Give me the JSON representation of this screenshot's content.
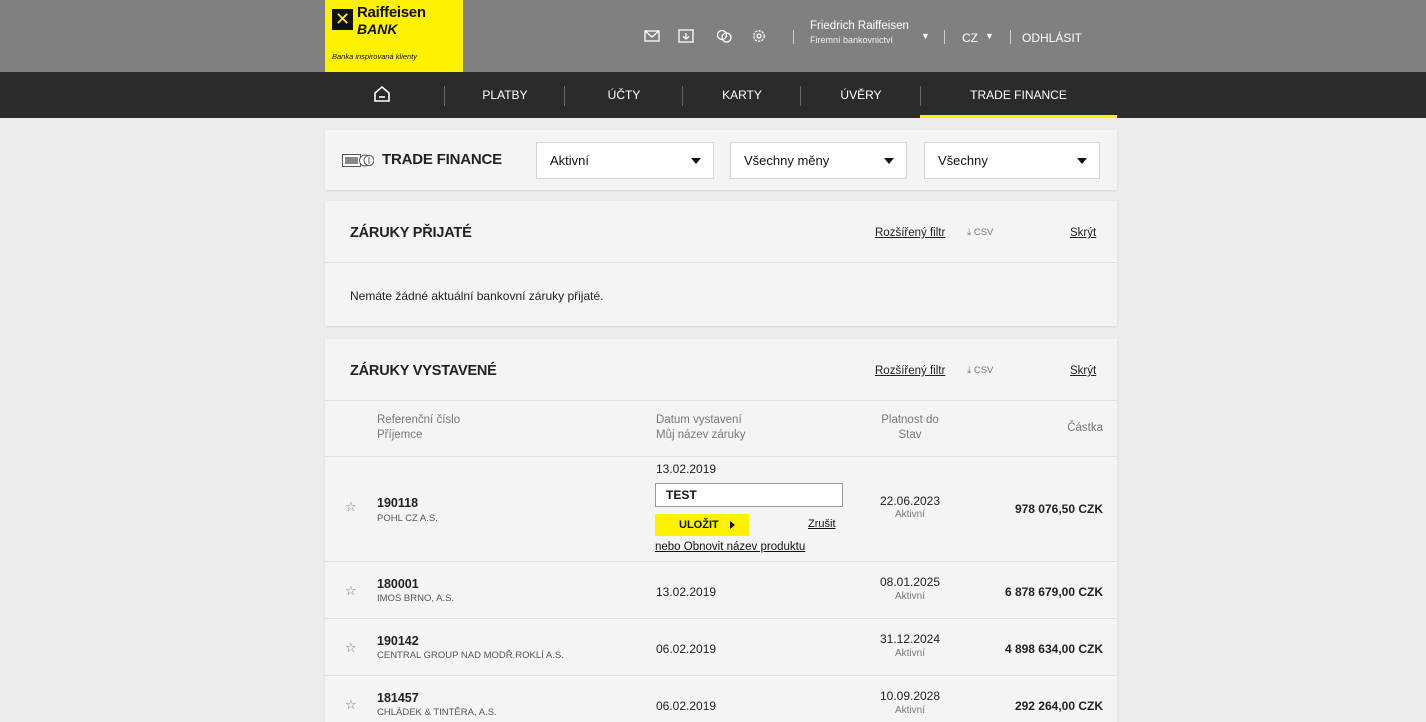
{
  "brand": {
    "name_line1": "Raiffeisen",
    "name_line2": "BANK",
    "slogan": "Banka inspirovaná klienty",
    "accent_color": "#fff200"
  },
  "header": {
    "icons": [
      "mail-icon",
      "download-icon",
      "exchange-icon",
      "settings-icon"
    ],
    "user_name": "Friedrich Raiffeisen",
    "user_role": "Firemní bankovnictví",
    "language": "CZ",
    "logout_label": "ODHLÁSIT"
  },
  "nav": {
    "items": [
      {
        "label": "PLATBY"
      },
      {
        "label": "ÚČTY"
      },
      {
        "label": "KARTY"
      },
      {
        "label": "ÚVĚRY"
      },
      {
        "label": "TRADE FINANCE",
        "active": true
      }
    ]
  },
  "filter": {
    "title": "TRADE FINANCE",
    "status_value": "Aktivní",
    "currency_value": "Všechny měny",
    "type_value": "Všechny"
  },
  "received": {
    "title": "ZÁRUKY PŘIJATÉ",
    "advanced_filter": "Rozšířený filtr",
    "csv": "⤓ CSV",
    "hide": "Skrýt",
    "empty_message": "Nemáte žádné aktuální bankovní záruky přijaté."
  },
  "issued": {
    "title": "ZÁRUKY VYSTAVENÉ",
    "advanced_filter": "Rozšířený filtr",
    "csv": "⤓ CSV",
    "hide": "Skrýt",
    "columns": {
      "ref": "Referenční číslo",
      "recipient": "Příjemce",
      "issue_date": "Datum vystavení",
      "my_name": "Můj název záruky",
      "valid_until": "Platnost do",
      "state": "Stav",
      "amount": "Částka"
    },
    "editing": {
      "ref": "190118",
      "recipient": "POHL CZ A.S.",
      "issue_date": "13.02.2019",
      "name_value": "TEST",
      "save_label": "ULOŽIT",
      "cancel_label": "Zrušit",
      "restore_label": "nebo Obnovit název produktu",
      "valid_until": "22.06.2023",
      "state": "Aktivní",
      "amount": "978 076,50 CZK"
    },
    "rows": [
      {
        "ref": "180001",
        "recipient": "IMOS BRNO, A.S.",
        "issue_date": "13.02.2019",
        "valid_until": "08.01.2025",
        "state": "Aktivní",
        "amount": "6 878 679,00 CZK"
      },
      {
        "ref": "190142",
        "recipient": "CENTRAL GROUP NAD MODŘ.ROKLÍ A.S.",
        "issue_date": "06.02.2019",
        "valid_until": "31.12.2024",
        "state": "Aktivní",
        "amount": "4 898 634,00 CZK"
      },
      {
        "ref": "181457",
        "recipient": "CHLÁDEK & TINTĚRA, A.S.",
        "issue_date": "06.02.2019",
        "valid_until": "10.09.2028",
        "state": "Aktivní",
        "amount": "292 264,00 CZK"
      }
    ]
  }
}
